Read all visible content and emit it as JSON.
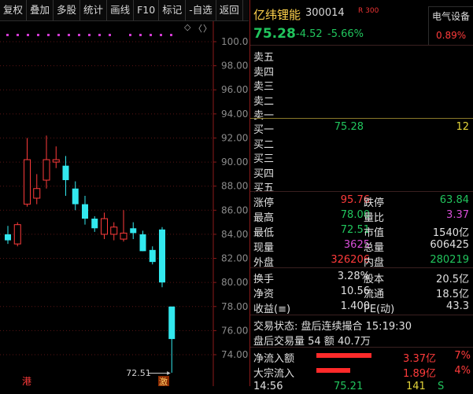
{
  "toolbar": [
    "复权",
    "叠加",
    "多股",
    "统计",
    "画线",
    "F10",
    "标记",
    "-自选",
    "返回"
  ],
  "chart_controls": {
    "diamond": "◇",
    "left": "〈",
    "right": "〉"
  },
  "chart_data": {
    "type": "candlestick",
    "yticks": [
      "100.0",
      "98.00",
      "96.00",
      "94.00",
      "92.00",
      "90.00",
      "88.00",
      "86.00",
      "84.00",
      "82.00",
      "80.00",
      "78.00",
      "76.00",
      "74.00"
    ],
    "ylim": [
      72.0,
      101.0
    ],
    "candles": [
      {
        "o": 84.0,
        "h": 84.7,
        "l": 83.2,
        "c": 83.5
      },
      {
        "o": 83.2,
        "h": 85.0,
        "l": 83.0,
        "c": 84.8
      },
      {
        "o": 86.5,
        "h": 92.0,
        "l": 86.3,
        "c": 90.2
      },
      {
        "o": 87.0,
        "h": 89.0,
        "l": 86.5,
        "c": 87.8
      },
      {
        "o": 88.5,
        "h": 92.2,
        "l": 87.8,
        "c": 90.2
      },
      {
        "o": 90.0,
        "h": 91.3,
        "l": 89.5,
        "c": 90.2
      },
      {
        "o": 89.7,
        "h": 90.5,
        "l": 87.2,
        "c": 88.5
      },
      {
        "o": 87.8,
        "h": 88.4,
        "l": 86.0,
        "c": 86.5
      },
      {
        "o": 86.5,
        "h": 87.2,
        "l": 84.8,
        "c": 85.3
      },
      {
        "o": 85.3,
        "h": 85.5,
        "l": 84.2,
        "c": 84.5
      },
      {
        "o": 84.0,
        "h": 85.8,
        "l": 83.6,
        "c": 85.3
      },
      {
        "o": 84.0,
        "h": 85.0,
        "l": 83.5,
        "c": 84.6
      },
      {
        "o": 83.6,
        "h": 86.0,
        "l": 83.4,
        "c": 84.1
      },
      {
        "o": 84.5,
        "h": 85.0,
        "l": 83.6,
        "c": 84.1
      },
      {
        "o": 84.0,
        "h": 84.3,
        "l": 82.6,
        "c": 82.6
      },
      {
        "o": 82.7,
        "h": 83.0,
        "l": 81.5,
        "c": 81.7
      },
      {
        "o": 84.4,
        "h": 84.6,
        "l": 79.6,
        "c": 80.0
      },
      {
        "o": 78.0,
        "h": 78.0,
        "l": 72.5,
        "c": 75.3
      }
    ],
    "low_label": "72.51",
    "markers": [
      {
        "text": "港",
        "color": "#ff3b3b"
      },
      {
        "text": "激",
        "color": "#ff3b3b"
      }
    ]
  },
  "quote": {
    "name": "亿纬锂能",
    "code": "300014",
    "r_badge": "R 300",
    "sector": "电气设备",
    "sector_pct": "0.89%",
    "price": "75.28",
    "change": "-4.52",
    "change_pct": "-5.66%"
  },
  "sell": [
    "卖五",
    "卖四",
    "卖三",
    "卖二",
    "卖一"
  ],
  "buy": [
    {
      "label": "买一",
      "price": "75.28",
      "vol": "12"
    },
    {
      "label": "买二",
      "price": "",
      "vol": ""
    },
    {
      "label": "买三",
      "price": "",
      "vol": ""
    },
    {
      "label": "买四",
      "price": "",
      "vol": ""
    },
    {
      "label": "买五",
      "price": "",
      "vol": ""
    }
  ],
  "stats": [
    {
      "l1": "涨停",
      "v1": "95.76",
      "c1": "red",
      "l2": "跌停",
      "v2": "63.84",
      "c2": "green"
    },
    {
      "l1": "最高",
      "v1": "78.00",
      "c1": "green",
      "l2": "量比",
      "v2": "3.37",
      "c2": "magenta"
    },
    {
      "l1": "最低",
      "v1": "72.51",
      "c1": "green",
      "l2": "市值",
      "v2": "1540亿",
      "c2": "white"
    },
    {
      "l1": "现量",
      "v1": "3625",
      "c1": "magenta",
      "l2": "总量",
      "v2": "606425",
      "c2": "white"
    },
    {
      "l1": "外盘",
      "v1": "326206",
      "c1": "red",
      "l2": "内盘",
      "v2": "280219",
      "c2": "green"
    }
  ],
  "fund": [
    {
      "l1": "换手",
      "v1": "3.28%",
      "l2": "股本",
      "v2": "20.5亿"
    },
    {
      "l1": "净资",
      "v1": "10.56",
      "l2": "流通",
      "v2": "18.5亿"
    },
    {
      "l1": "收益(≡)",
      "v1": "1.400",
      "l2": "PE(动)",
      "v2": "43.3"
    }
  ],
  "trade_status": "交易状态: 盘后连续撮合 15:19:30",
  "after_hours": "盘后交易量 54 额 40.7万",
  "flows": [
    {
      "label": "净流入额",
      "bar_pct": 1.0,
      "val": "3.37亿",
      "pct": "7%"
    },
    {
      "label": "大宗流入",
      "bar_pct": 0.62,
      "val": "1.89亿",
      "pct": "4%"
    }
  ],
  "tick_row": {
    "time": "14:56",
    "price": "75.21",
    "vol": "141",
    "flag": "S"
  }
}
